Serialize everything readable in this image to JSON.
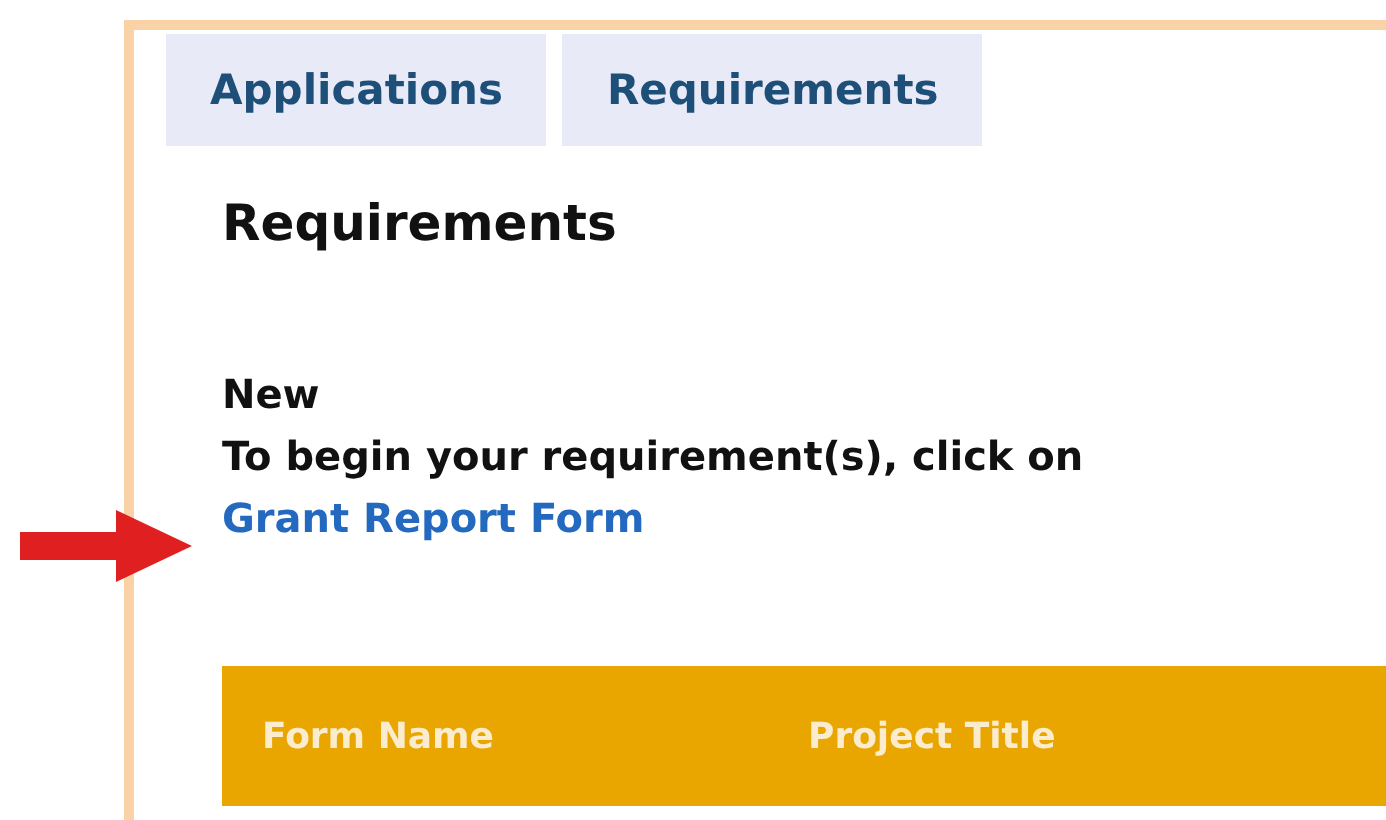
{
  "tabs": [
    {
      "label": "Applications"
    },
    {
      "label": "Requirements"
    }
  ],
  "heading": "Requirements",
  "section": {
    "title": "New",
    "instruction": "To begin your requirement(s), click on",
    "link": "Grant Report Form"
  },
  "table": {
    "columns": [
      "Form Name",
      "Project Title"
    ]
  }
}
